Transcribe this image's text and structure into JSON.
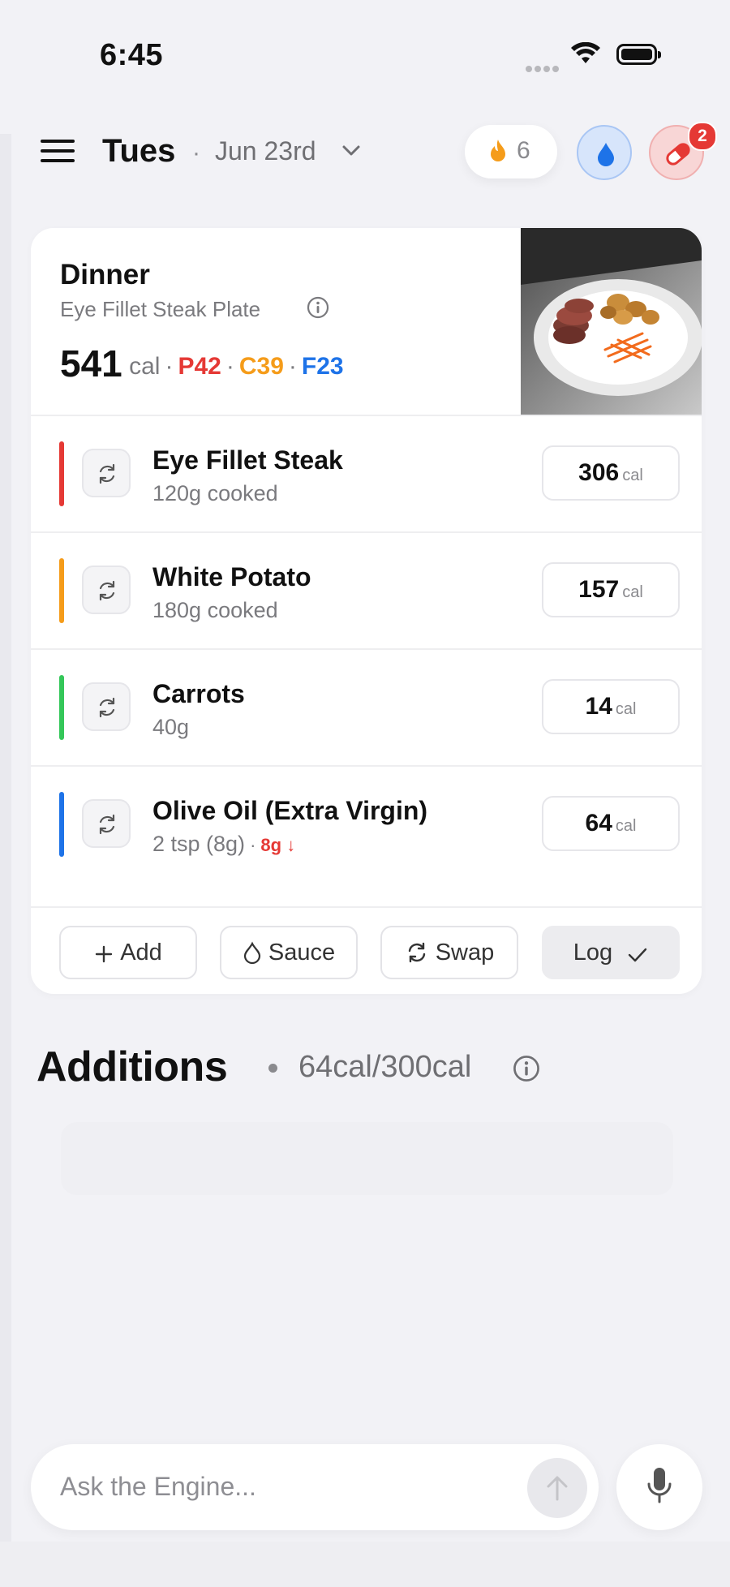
{
  "status_bar": {
    "time": "6:45"
  },
  "header": {
    "day": "Tues",
    "separator": "·",
    "date": "Jun 23rd",
    "streak_count": "6",
    "notification_badge": "2"
  },
  "meal": {
    "title": "Dinner",
    "name": "Eye Fillet Steak Plate",
    "calories": "541",
    "calories_unit": "cal",
    "dot": "·",
    "protein": "P42",
    "carbs": "C39",
    "fat": "F23",
    "items": [
      {
        "name": "Eye Fillet Steak",
        "amount": "120g cooked",
        "cal": "306",
        "unit": "cal",
        "color": "#e53935"
      },
      {
        "name": "White Potato",
        "amount": "180g cooked",
        "cal": "157",
        "unit": "cal",
        "color": "#f59c1a"
      },
      {
        "name": "Carrots",
        "amount": "40g",
        "cal": "14",
        "unit": "cal",
        "color": "#34c759"
      },
      {
        "name": "Olive Oil (Extra Virgin)",
        "amount": "2 tsp (8g)",
        "adjust": "8g",
        "cal": "64",
        "unit": "cal",
        "color": "#1e73e8"
      }
    ],
    "actions": {
      "add": "Add",
      "sauce": "Sauce",
      "swap": "Swap",
      "log": "Log"
    }
  },
  "additions": {
    "title": "Additions",
    "budget": "64cal/300cal"
  },
  "ask": {
    "placeholder": "Ask the Engine..."
  },
  "colors": {
    "protein": "#e53935",
    "carbs": "#f59c1a",
    "fat": "#1e73e8",
    "background": "#f2f2f6"
  }
}
